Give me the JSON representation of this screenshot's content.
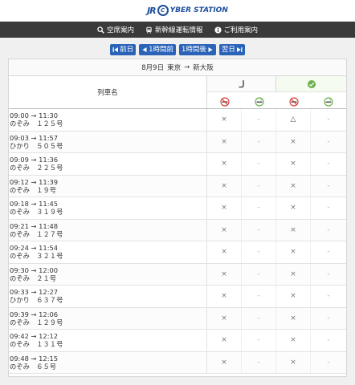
{
  "header": {
    "logo_jr": "JR",
    "logo_ring": "C",
    "logo_word": "YBER STATION"
  },
  "nav": [
    {
      "label": "空席案内",
      "icon": "search-icon"
    },
    {
      "label": "新幹線運転情報",
      "icon": "train-icon"
    },
    {
      "label": "ご利用案内",
      "icon": "info-icon"
    }
  ],
  "pager": {
    "prev_day": "前日",
    "prev_hour": "1時間前",
    "next_hour": "1時間後",
    "next_day": "翌日"
  },
  "route": {
    "date": "8月9日",
    "from": "東京",
    "arrow": "→",
    "to": "新大阪"
  },
  "table": {
    "col_train": "列車名",
    "seat_groups": [
      {
        "icon": "ordinary-car-icon"
      },
      {
        "icon": "green-car-icon"
      }
    ],
    "subheaders": [
      "no-smoking-icon",
      "smoking-icon",
      "no-smoking-icon",
      "smoking-icon"
    ],
    "rows": [
      {
        "time": "09:00 → 11:30",
        "train": "のぞみ　１２５号",
        "seats": [
          "×",
          "-",
          "△",
          "-"
        ]
      },
      {
        "time": "09:03 → 11:57",
        "train": "ひかり　５０５号",
        "seats": [
          "×",
          "-",
          "×",
          "-"
        ]
      },
      {
        "time": "09:09 → 11:36",
        "train": "のぞみ　２２５号",
        "seats": [
          "×",
          "-",
          "×",
          "-"
        ]
      },
      {
        "time": "09:12 → 11:39",
        "train": "のぞみ　１９号",
        "seats": [
          "×",
          "-",
          "×",
          "-"
        ]
      },
      {
        "time": "09:18 → 11:45",
        "train": "のぞみ　３１９号",
        "seats": [
          "×",
          "-",
          "×",
          "-"
        ]
      },
      {
        "time": "09:21 → 11:48",
        "train": "のぞみ　１２７号",
        "seats": [
          "×",
          "-",
          "×",
          "-"
        ]
      },
      {
        "time": "09:24 → 11:54",
        "train": "のぞみ　３２１号",
        "seats": [
          "×",
          "-",
          "×",
          "-"
        ]
      },
      {
        "time": "09:30 → 12:00",
        "train": "のぞみ　２１号",
        "seats": [
          "×",
          "-",
          "×",
          "-"
        ]
      },
      {
        "time": "09:33 → 12:27",
        "train": "ひかり　６３７号",
        "seats": [
          "×",
          "-",
          "×",
          "-"
        ]
      },
      {
        "time": "09:39 → 12:06",
        "train": "のぞみ　１２９号",
        "seats": [
          "×",
          "-",
          "×",
          "-"
        ]
      },
      {
        "time": "09:42 → 12:12",
        "train": "のぞみ　１３１号",
        "seats": [
          "×",
          "-",
          "×",
          "-"
        ]
      },
      {
        "time": "09:48 → 12:15",
        "train": "のぞみ　６５号",
        "seats": [
          "×",
          "-",
          "×",
          "-"
        ]
      }
    ]
  },
  "colors": {
    "nav_bg": "#3a3a3a",
    "button_blue": "#2a63b8",
    "green": "#6ab04c",
    "red": "#d9403a",
    "logo_blue": "#1d4f9c"
  }
}
